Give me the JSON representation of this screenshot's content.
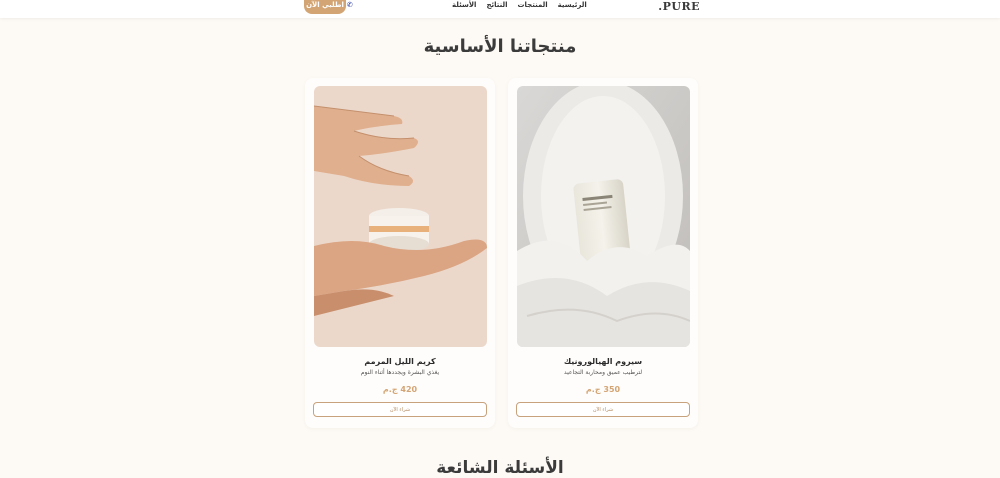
{
  "header": {
    "logo": ".PURE",
    "nav": [
      "الرئيسية",
      "المنتجات",
      "النتائج",
      "الأسئلة"
    ],
    "order_button": "اطلبي الآن",
    "phone_icon": "phone-icon"
  },
  "products_section": {
    "title": "منتجاتنا الأساسية",
    "products": [
      {
        "name": "سيروم الهيالورونيك",
        "description": "لترطيب عميق ومحاربة التجاعيد",
        "price": "350 ج.م",
        "button": "شراء الآن"
      },
      {
        "name": "كريم الليل المرمم",
        "description": "يغذي البشرة ويجددها أثناء النوم",
        "price": "420 ج.م",
        "button": "شراء الآن"
      }
    ]
  },
  "faq": {
    "title": "الأسئلة الشائعة"
  },
  "colors": {
    "accent": "#d4a574",
    "background": "#fdf9f4"
  }
}
